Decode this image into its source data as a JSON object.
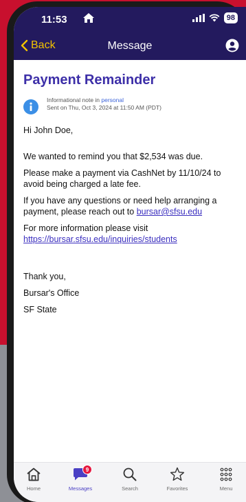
{
  "status_bar": {
    "time": "11:53",
    "battery": "98"
  },
  "nav": {
    "back_label": "Back",
    "title": "Message"
  },
  "message": {
    "title": "Payment Remainder",
    "meta_prefix": "Informational note in ",
    "meta_category": "personal",
    "meta_sent": "Sent on Thu, Oct 3, 2024 at 11:50 AM (PDT)",
    "greeting": "Hi John Doe,",
    "para1": "We wanted to remind you that $2,534 was due.",
    "para2": "Please make a payment via CashNet by 11/10/24 to avoid being charged a late fee.",
    "para3_text": "If you have any questions or need help arranging a payment, please reach out to ",
    "para3_link": "bursar@sfsu.edu",
    "para4_text": "For more information please visit",
    "para4_link": "https://bursar.sfsu.edu/inquiries/students",
    "closing": "Thank you,",
    "office": "Bursar's Office",
    "org": "SF State"
  },
  "tabbar": {
    "home": "Home",
    "messages": "Messages",
    "messages_badge": "9",
    "search": "Search",
    "favorites": "Favorites",
    "menu": "Menu"
  },
  "colors": {
    "nav_background": "#231a5e",
    "back_accent": "#f2c200",
    "title_purple": "#3d2fa8",
    "badge_red": "#e5173f",
    "active_tab": "#4a3fc4"
  }
}
